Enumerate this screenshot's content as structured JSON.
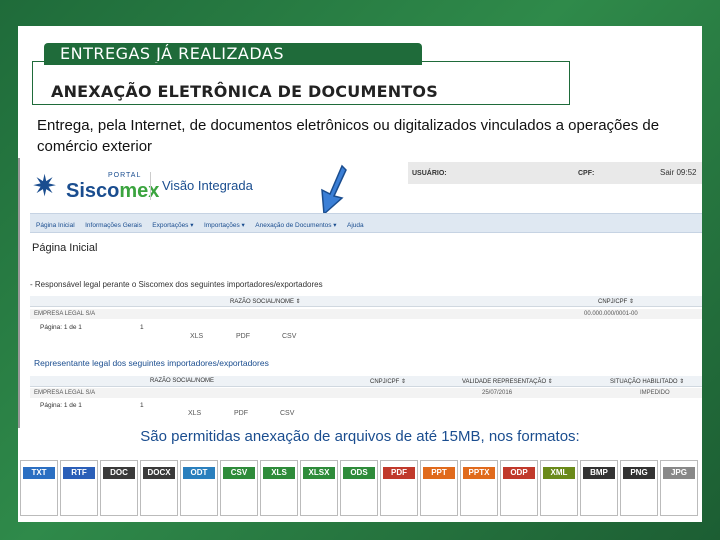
{
  "header": {
    "tab_label": "ENTREGAS JÁ REALIZADAS",
    "title": "ANEXAÇÃO ELETRÔNICA DE DOCUMENTOS"
  },
  "intro_text": "Entrega, pela Internet, de documentos eletrônicos ou digitalizados vinculados a operações de comércio exterior",
  "screenshot": {
    "topbar": {
      "user_label": "USUÁRIO:",
      "cpf_label": "CPF:",
      "session": "Sair 09:52"
    },
    "logo": {
      "portal": "PORTAL",
      "name_a": "Sisco",
      "name_b": "mex"
    },
    "app_title": "Visão Integrada",
    "nav_items": [
      "Página Inicial",
      "Informações Gerais",
      "Exportações ▾",
      "Importações ▾",
      "Anexação de Documentos ▾",
      "Ajuda"
    ],
    "page_title": "Página Inicial",
    "resp_label": "- Responsável legal perante o Siscomex dos seguintes importadores/exportadores",
    "table1": {
      "col_razao": "RAZÃO SOCIAL/NOME ⇕",
      "col_cnpj": "CNPJ/CPF ⇕",
      "row_name": "EMPRESA LEGAL S/A",
      "row_id": "00.000.000/0001-00"
    },
    "pager1": "Página: 1 de 1",
    "pager_num": "1",
    "formats": {
      "xls": "XLS",
      "pdf": "PDF",
      "csv": "CSV"
    },
    "section2": "Representante legal dos seguintes importadores/exportadores",
    "table2": {
      "col_razao": "RAZÃO SOCIAL/NOME",
      "col_cnpj": "CNPJ/CPF ⇕",
      "col_validade": "VALIDADE REPRESENTAÇÃO ⇕",
      "col_sit": "SITUAÇÃO HABILITADO ⇕",
      "row_name": "EMPRESA LEGAL S/A",
      "row_date": "25/07/2016",
      "row_sit": "IMPEDIDO"
    },
    "pager2": "Página: 1 de 1"
  },
  "caption": "São permitidas anexação de arquivos de até 15MB, nos formatos:",
  "file_formats": [
    {
      "label": "TXT",
      "color": "#2b6fc2"
    },
    {
      "label": "RTF",
      "color": "#2b5fb8"
    },
    {
      "label": "DOC",
      "color": "#3a3a3a"
    },
    {
      "label": "DOCX",
      "color": "#3a3a3a"
    },
    {
      "label": "ODT",
      "color": "#2a7fbd"
    },
    {
      "label": "CSV",
      "color": "#2e8b3a"
    },
    {
      "label": "XLS",
      "color": "#2e8b3a"
    },
    {
      "label": "XLSX",
      "color": "#2e8b3a"
    },
    {
      "label": "ODS",
      "color": "#2e8b3a"
    },
    {
      "label": "PDF",
      "color": "#c0392b"
    },
    {
      "label": "PPT",
      "color": "#e06a1c"
    },
    {
      "label": "PPTX",
      "color": "#e06a1c"
    },
    {
      "label": "ODP",
      "color": "#c0392b"
    },
    {
      "label": "XML",
      "color": "#6a8a1a"
    },
    {
      "label": "BMP",
      "color": "#333333"
    },
    {
      "label": "PNG",
      "color": "#333333"
    },
    {
      "label": "JPG",
      "color": "#888888"
    }
  ]
}
